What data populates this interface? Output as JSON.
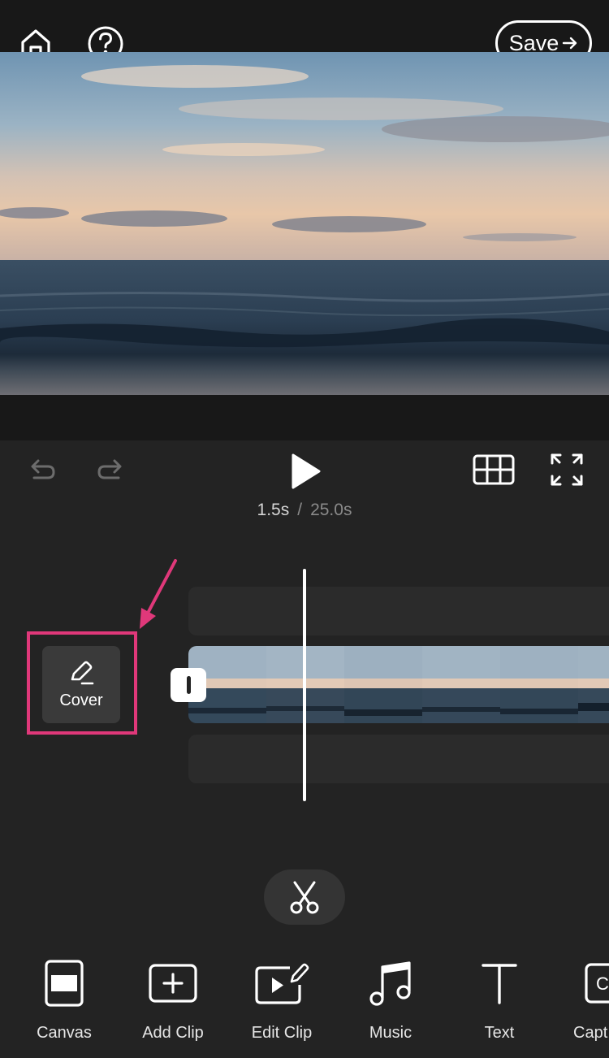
{
  "header": {
    "home_icon": "home-icon",
    "help_icon": "help-icon",
    "save_label": "Save"
  },
  "playback": {
    "current_time": "1.5s",
    "separator": "/",
    "total_time": "25.0s"
  },
  "timeline": {
    "cover_label": "Cover",
    "progress_fraction": 0.06
  },
  "toolbar": {
    "items": [
      {
        "label": "Canvas",
        "icon": "canvas-icon"
      },
      {
        "label": "Add Clip",
        "icon": "add-clip-icon"
      },
      {
        "label": "Edit Clip",
        "icon": "edit-clip-icon"
      },
      {
        "label": "Music",
        "icon": "music-icon"
      },
      {
        "label": "Text",
        "icon": "text-icon"
      },
      {
        "label": "Capt",
        "icon": "captions-icon"
      }
    ]
  },
  "colors": {
    "background": "#232323",
    "header": "#181818",
    "highlight": "#e0387a"
  }
}
